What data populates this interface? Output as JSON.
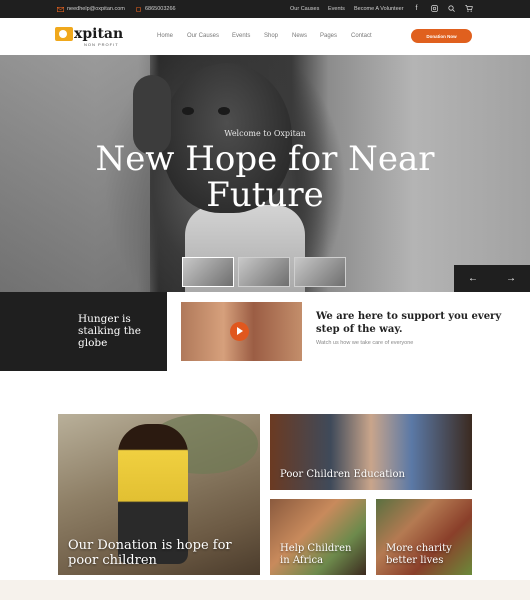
{
  "topbar": {
    "email": "needhelp@oxpitan.com",
    "phone": "6865003266",
    "links": [
      "Our Causes",
      "Events",
      "Become A Volunteer"
    ],
    "social_icons": [
      "facebook-icon",
      "instagram-icon",
      "search-icon",
      "cart-icon"
    ]
  },
  "header": {
    "logo_text": "xpitan",
    "logo_sub": "NON PROFIT",
    "nav": [
      "Home",
      "Our Causes",
      "Events",
      "Shop",
      "News",
      "Pages",
      "Contact"
    ],
    "donate_label": "Donation Now",
    "accent": "#e0601e",
    "logo_color": "#f0a81c"
  },
  "hero": {
    "subtitle": "Welcome to Oxpitan",
    "title": "New Hope for Near Future",
    "prev_icon": "arrow-left-icon",
    "next_icon": "arrow-right-icon"
  },
  "intro": {
    "hunger": "Hunger is stalking the globe",
    "heading": "We are here to support you every step of the way.",
    "text": "Watch us how we take care of everyone"
  },
  "cards": {
    "donation": "Our Donation is hope for poor children",
    "education": "Poor Children Education",
    "help": "Help Children in Africa",
    "charity": "More charity better lives"
  }
}
